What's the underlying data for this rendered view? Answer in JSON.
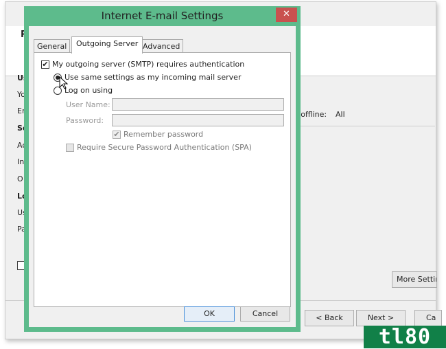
{
  "background_window": {
    "header_letter": "P",
    "labels": [
      {
        "text": "Us",
        "bold": true
      },
      {
        "text": "Yo"
      },
      {
        "text": "Em"
      },
      {
        "text": "Se",
        "bold": true
      },
      {
        "text": "Ac"
      },
      {
        "text": "In"
      },
      {
        "text": "O"
      },
      {
        "text": "Lo",
        "bold": true
      },
      {
        "text": "Us"
      },
      {
        "text": "Pa"
      }
    ],
    "offline_label": "o offline:",
    "offline_value": "All",
    "more_settings": "More Settin",
    "back": "< Back",
    "next": "Next >",
    "cancel": "Ca"
  },
  "dialog": {
    "title": "Internet E-mail Settings",
    "close": "✕",
    "tabs": [
      {
        "label": "General"
      },
      {
        "label": "Outgoing Server",
        "active": true
      },
      {
        "label": "Advanced"
      }
    ],
    "smtp_auth": {
      "label": "My outgoing server (SMTP) requires authentication",
      "checked": true
    },
    "radio_same": {
      "label": "Use same settings as my incoming mail server",
      "selected": true
    },
    "radio_logon": {
      "label": "Log on using",
      "selected": false
    },
    "user_name_label": "User Name:",
    "user_name_value": "",
    "password_label": "Password:",
    "password_value": "",
    "remember": {
      "label": "Remember password",
      "checked": true
    },
    "spa": {
      "label": "Require Secure Password Authentication (SPA)",
      "checked": false
    },
    "ok": "OK",
    "cancel": "Cancel"
  },
  "watermark": "tl80",
  "colors": {
    "dialog_border": "#5dbb8c",
    "close": "#c9514f",
    "logo": "#118048"
  }
}
